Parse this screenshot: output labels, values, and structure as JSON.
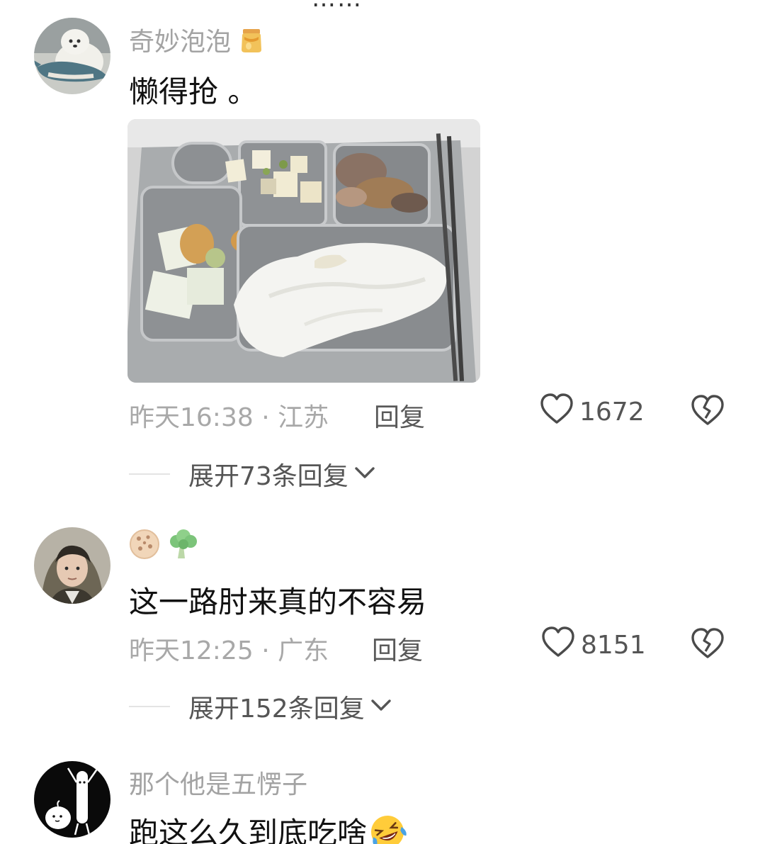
{
  "top_cut_text": "……",
  "comments": [
    {
      "username": "奇妙泡泡",
      "username_badge_icon": "honey-jar-icon",
      "text": "懒得抢 。",
      "has_image": true,
      "image_semantic": "cafeteria-tray-photo",
      "time_location": "昨天16:38 · 江苏",
      "reply_label": "回复",
      "likes": "1672",
      "expand_label": "展开73条回复"
    },
    {
      "username_icons": [
        "cookie-icon",
        "broccoli-icon"
      ],
      "text": "这一路肘来真的不容易",
      "time_location": "昨天12:25 · 广东",
      "reply_label": "回复",
      "likes": "8151",
      "expand_label": "展开152条回复"
    },
    {
      "username": "那个他是五愣子",
      "text": "跑这么久到底吃啥",
      "text_trailing_icon": "rolling-laughing-face-icon"
    }
  ],
  "colors": {
    "username": "#a3a3a3",
    "meta": "#a8a8a8",
    "text": "#111111",
    "action": "#555555",
    "divider": "#e4e4e4"
  }
}
